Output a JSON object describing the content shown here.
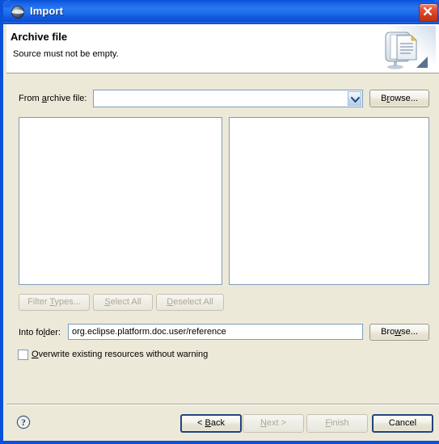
{
  "window": {
    "title": "Import",
    "icon": "eclipse-globe-icon",
    "close_label": "Close",
    "frame_color": "#0a50d8",
    "titlebar_gradient_from": "#0a4fd4",
    "titlebar_gradient_to": "#2a79f0",
    "body_background": "#ece9d8"
  },
  "header": {
    "title": "Archive file",
    "subtitle": "Source must not be empty.",
    "icon": "archive-import-banner-icon",
    "background": "#ffffff"
  },
  "form": {
    "from_archive": {
      "label_prefix": "From ",
      "label_mnemonic": "a",
      "label_suffix": "rchive file:",
      "value": "",
      "placeholder": "",
      "dropdown_icon": "chevron-down-icon",
      "browse": {
        "prefix": "B",
        "mnemonic": "r",
        "suffix": "owse...",
        "enabled": true
      }
    },
    "left_tree": {
      "items": [],
      "empty": true
    },
    "right_tree": {
      "items": [],
      "empty": true
    },
    "filter_buttons": [
      {
        "name": "filter-types-button",
        "prefix": "Filter ",
        "mnemonic": "T",
        "suffix": "ypes...",
        "enabled": false
      },
      {
        "name": "select-all-button",
        "prefix": "",
        "mnemonic": "S",
        "suffix": "elect All",
        "enabled": false
      },
      {
        "name": "deselect-all-button",
        "prefix": "",
        "mnemonic": "D",
        "suffix": "eselect All",
        "enabled": false
      }
    ],
    "into_folder": {
      "label_prefix": "Into fo",
      "label_mnemonic": "l",
      "label_suffix": "der:",
      "value": "org.eclipse.platform.doc.user/reference",
      "browse": {
        "prefix": "Bro",
        "mnemonic": "w",
        "suffix": "se...",
        "enabled": true
      }
    },
    "overwrite": {
      "prefix": "",
      "mnemonic": "O",
      "suffix": "verwrite existing resources without warning",
      "checked": false
    }
  },
  "footer": {
    "help_icon": "help-question-icon",
    "buttons": [
      {
        "name": "back-button",
        "prefix": "< ",
        "mnemonic": "B",
        "suffix": "ack",
        "enabled": true,
        "default": true
      },
      {
        "name": "next-button",
        "prefix": "",
        "mnemonic": "N",
        "suffix": "ext >",
        "enabled": false,
        "default": false
      },
      {
        "name": "finish-button",
        "prefix": "",
        "mnemonic": "F",
        "suffix": "inish",
        "enabled": false,
        "default": false
      },
      {
        "name": "cancel-button",
        "prefix": "Cancel",
        "mnemonic": "",
        "suffix": "",
        "enabled": true,
        "default": false
      }
    ]
  }
}
